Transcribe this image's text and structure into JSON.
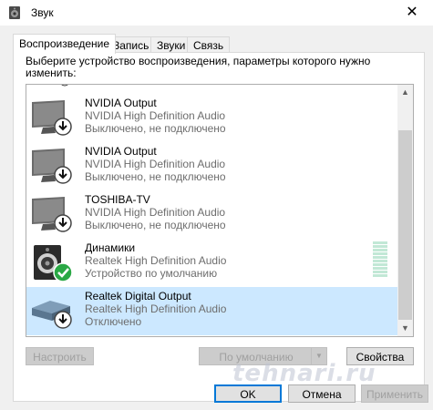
{
  "window": {
    "title": "Звук",
    "icon": "speaker-icon",
    "close": "✕"
  },
  "tabs": [
    {
      "label": "Воспроизведение",
      "active": true
    },
    {
      "label": "Запись",
      "active": false
    },
    {
      "label": "Звуки",
      "active": false
    },
    {
      "label": "Связь",
      "active": false
    }
  ],
  "instruction": "Выберите устройство воспроизведения, параметры которого нужно изменить:",
  "devices": [
    {
      "name": "NVIDIA Output",
      "description": "NVIDIA High Definition Audio",
      "status": "Выключено, не подключено",
      "icon": "monitor-icon",
      "badge": "down-arrow"
    },
    {
      "name": "NVIDIA Output",
      "description": "NVIDIA High Definition Audio",
      "status": "Выключено, не подключено",
      "icon": "monitor-icon",
      "badge": "down-arrow"
    },
    {
      "name": "TOSHIBA-TV",
      "description": "NVIDIA High Definition Audio",
      "status": "Выключено, не подключено",
      "icon": "monitor-icon",
      "badge": "down-arrow"
    },
    {
      "name": "Динамики",
      "description": "Realtek High Definition Audio",
      "status": "Устройство по умолчанию",
      "icon": "speaker-icon",
      "badge": "check"
    },
    {
      "name": "Realtek Digital Output",
      "description": "Realtek High Definition Audio",
      "status": "Отключено",
      "icon": "digital-output-icon",
      "badge": "down-arrow",
      "selected": true
    }
  ],
  "buttons": {
    "configure": "Настроить",
    "set_default": "По умолчанию",
    "properties": "Свойства",
    "ok": "OK",
    "cancel": "Отмена",
    "apply": "Применить"
  },
  "watermark": "tehnari.ru",
  "colors": {
    "selection": "#cce8ff",
    "accent": "#0078d7",
    "check_green": "#2aa845"
  }
}
